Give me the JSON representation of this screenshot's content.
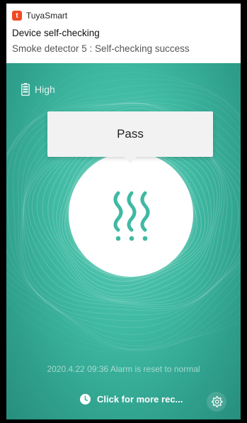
{
  "notification": {
    "app_icon_letter": "t",
    "app_name": "TuyaSmart",
    "title": "Device self-checking",
    "body": "Smoke detector 5 : Self-checking success"
  },
  "battery": {
    "icon": "battery-icon",
    "label": "High"
  },
  "tooltip": {
    "text": "Pass"
  },
  "device": {
    "icon": "smoke-icon"
  },
  "status": {
    "reset_text": "2020.4.22 09:36 Alarm is reset to normal"
  },
  "footer": {
    "more_icon": "clock-icon",
    "more_label": "Click for more rec...",
    "settings_icon": "gear-icon"
  },
  "colors": {
    "background": "#3fb9a2",
    "accent": "#3fb9a2",
    "app_icon": "#f04a24"
  }
}
